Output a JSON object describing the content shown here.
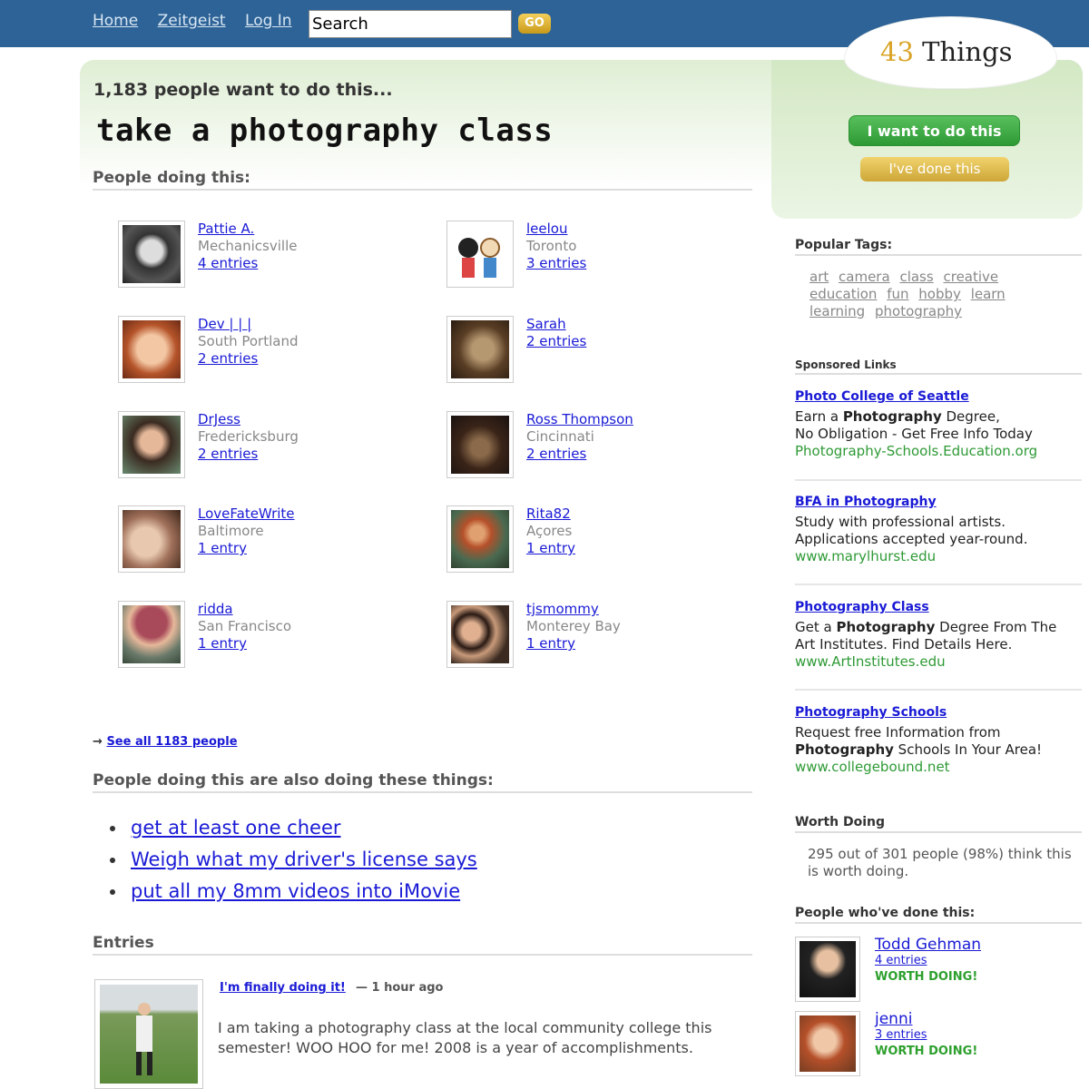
{
  "nav": {
    "home": "Home",
    "zeitgeist": "Zeitgeist",
    "login": "Log In",
    "search_value": "Search",
    "go": "GO"
  },
  "logo": {
    "number": "43",
    "word": "Things"
  },
  "header": {
    "count_text": "1,183 people want to do this...",
    "goal": "take a photography class",
    "want_button": "I want to do this",
    "done_button": "I've done this"
  },
  "people_section": "People doing this:",
  "people": [
    {
      "name": "Pattie A.",
      "city": "Mechanicsville",
      "entries": "4 entries"
    },
    {
      "name": "leelou",
      "city": "Toronto",
      "entries": "3 entries"
    },
    {
      "name": "Dev  | | |",
      "city": "South Portland",
      "entries": "2 entries"
    },
    {
      "name": "Sarah",
      "city": "",
      "entries": "2 entries"
    },
    {
      "name": "DrJess",
      "city": "Fredericksburg",
      "entries": "2 entries"
    },
    {
      "name": "Ross Thompson",
      "city": "Cincinnati",
      "entries": "2 entries"
    },
    {
      "name": "LoveFateWrite",
      "city": "Baltimore",
      "entries": "1 entry"
    },
    {
      "name": "Rita82",
      "city": "Açores",
      "entries": "1 entry"
    },
    {
      "name": "ridda",
      "city": "San Francisco",
      "entries": "1 entry"
    },
    {
      "name": "tjsmommy",
      "city": "Monterey Bay",
      "entries": "1 entry"
    }
  ],
  "see_all": "See all 1183 people",
  "also_section": "People doing this are also doing these things:",
  "also": [
    "get at least one cheer",
    "Weigh what my driver's license says",
    "put all my 8mm videos into iMovie"
  ],
  "entries_section": "Entries",
  "entry": {
    "title": "I'm finally doing it!",
    "time": "— 1 hour ago",
    "text": "I am taking a photography class at the local community college this semester! WOO HOO for me! 2008 is a year of accomplishments."
  },
  "sidebar": {
    "tags_head": "Popular Tags:",
    "tags": [
      "art",
      "camera",
      "class",
      "creative",
      "education",
      "fun",
      "hobby",
      "learn",
      "learning",
      "photography"
    ],
    "sponsored_head": "Sponsored Links",
    "ads": [
      {
        "title": "Photo College of Seattle",
        "line1a": "Earn a ",
        "line1b": "Photography",
        "line1c": " Degree,",
        "line2": "No Obligation - Get Free Info Today",
        "url": "Photography-Schools.Education.org"
      },
      {
        "title": "BFA in Photography",
        "line1a": "Study with professional artists.",
        "line1b": "",
        "line1c": "",
        "line2": "Applications accepted year-round.",
        "url": "www.marylhurst.edu"
      },
      {
        "title": "Photography Class",
        "line1a": "Get a ",
        "line1b": "Photography",
        "line1c": " Degree From The",
        "line2": "Art Institutes. Find Details Here.",
        "url": "www.ArtInstitutes.edu"
      },
      {
        "title": "Photography Schools",
        "line1a": "Request free Information from",
        "line1b": "",
        "line1c": "",
        "line2b": "Photography",
        "line2": " Schools In Your Area!",
        "url": "www.collegebound.net"
      }
    ],
    "worth_head": "Worth Doing",
    "worth_text": "295 out of 301 people (98%) think this is worth doing.",
    "done_head": "People who've done this:",
    "doers": [
      {
        "name": "Todd Gehman",
        "entries": "4 entries",
        "verdict": "WORTH DOING!"
      },
      {
        "name": "jenni",
        "entries": "3 entries",
        "verdict": "WORTH DOING!"
      }
    ]
  }
}
